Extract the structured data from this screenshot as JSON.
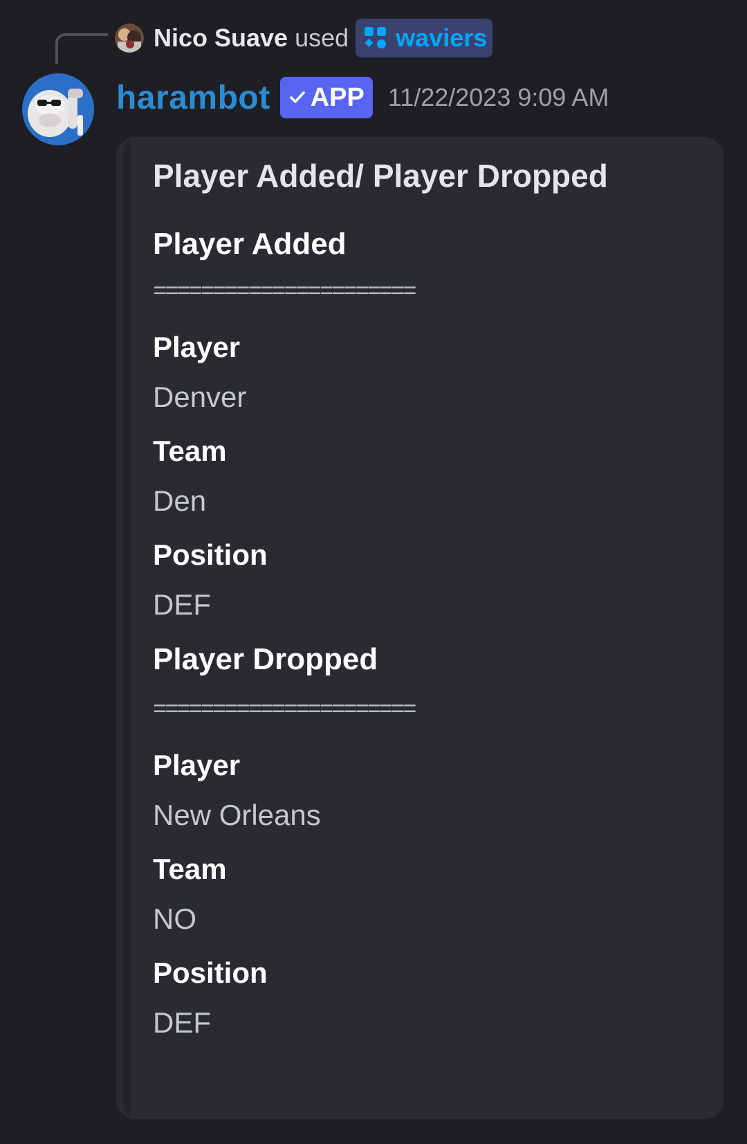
{
  "reply": {
    "user": "Nico Suave",
    "used_text": "used",
    "command": "waviers",
    "command_icon": "app-command-icon"
  },
  "message": {
    "author": "harambot",
    "badge": "APP",
    "timestamp": "11/22/2023 9:09 AM"
  },
  "embed": {
    "title": "Player Added/ Player Dropped",
    "added": {
      "heading": "Player Added",
      "divider": "======================",
      "fields": [
        {
          "name": "Player",
          "value": "Denver"
        },
        {
          "name": "Team",
          "value": "Den"
        },
        {
          "name": "Position",
          "value": "DEF"
        }
      ]
    },
    "dropped": {
      "heading": "Player Dropped",
      "divider": "======================",
      "fields": [
        {
          "name": "Player",
          "value": "New Orleans"
        },
        {
          "name": "Team",
          "value": "NO"
        },
        {
          "name": "Position",
          "value": "DEF"
        }
      ]
    }
  },
  "colors": {
    "background": "#1e1f24",
    "embed_bg": "#2a2b31",
    "bot_name": "#2c8cd3",
    "app_badge": "#5865f2",
    "command_pill": "#3c4270",
    "command_text": "#00a8fc"
  }
}
